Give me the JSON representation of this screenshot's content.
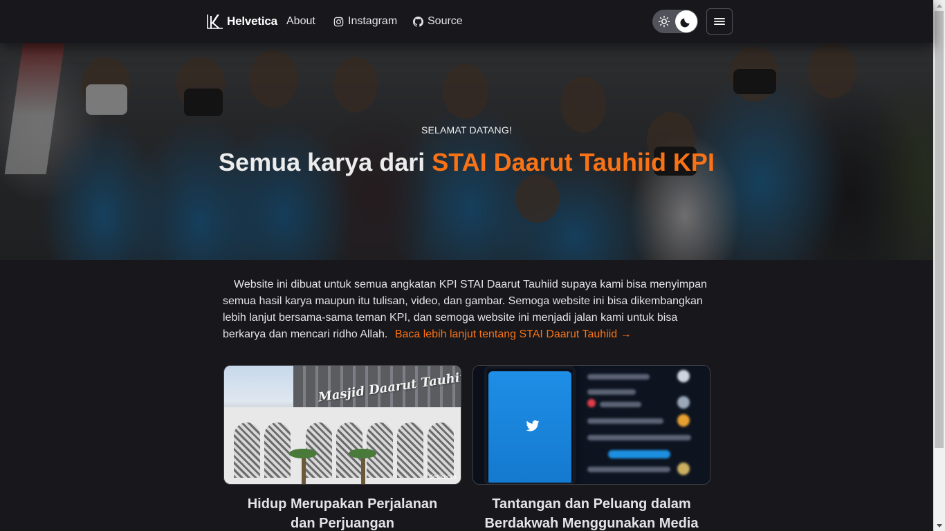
{
  "navbar": {
    "brand": "Helvetica",
    "links": [
      {
        "label": "About",
        "icon": null
      },
      {
        "label": "Instagram",
        "icon": "instagram-icon"
      },
      {
        "label": "Source",
        "icon": "github-icon"
      }
    ],
    "theme_toggle": {
      "light_icon": "sun-icon",
      "dark_icon": "moon-icon",
      "state": "dark"
    },
    "menu_icon": "hamburger-icon"
  },
  "hero": {
    "subtitle": "SELAMAT DATANG!",
    "title_prefix": "Semua karya dari",
    "title_highlight": "STAI Daarut Tauhiid KPI"
  },
  "intro": {
    "text": "Website ini dibuat untuk semua angkatan KPI STAI Daarut Tauhiid supaya kami bisa menyimpan semua hasil karya maupun itu tulisan, video, dan gambar. Semoga website ini bisa dikembangkan lebih lanjut bersama-sama teman KPI, dan semoga website ini menjadi jalan kami untuk bisa berkarya dan mencari ridho Allah.",
    "link_label": "Baca lebih lanjut tentang STAI Daarut Tauhiid →"
  },
  "cards": [
    {
      "title": "Hidup Merupakan Perjalanan dan Perjuangan",
      "image_sign": "Masjid Daarut Tauhiid",
      "image_watermark": "detikcom"
    },
    {
      "title": "Tantangan dan Peluang dalam Berdakwah Menggunakan Media Baru",
      "image_icon": "twitter-bird-icon"
    }
  ],
  "colors": {
    "background": "#18171b",
    "accent": "#f97316",
    "text": "#e4e4e7"
  }
}
